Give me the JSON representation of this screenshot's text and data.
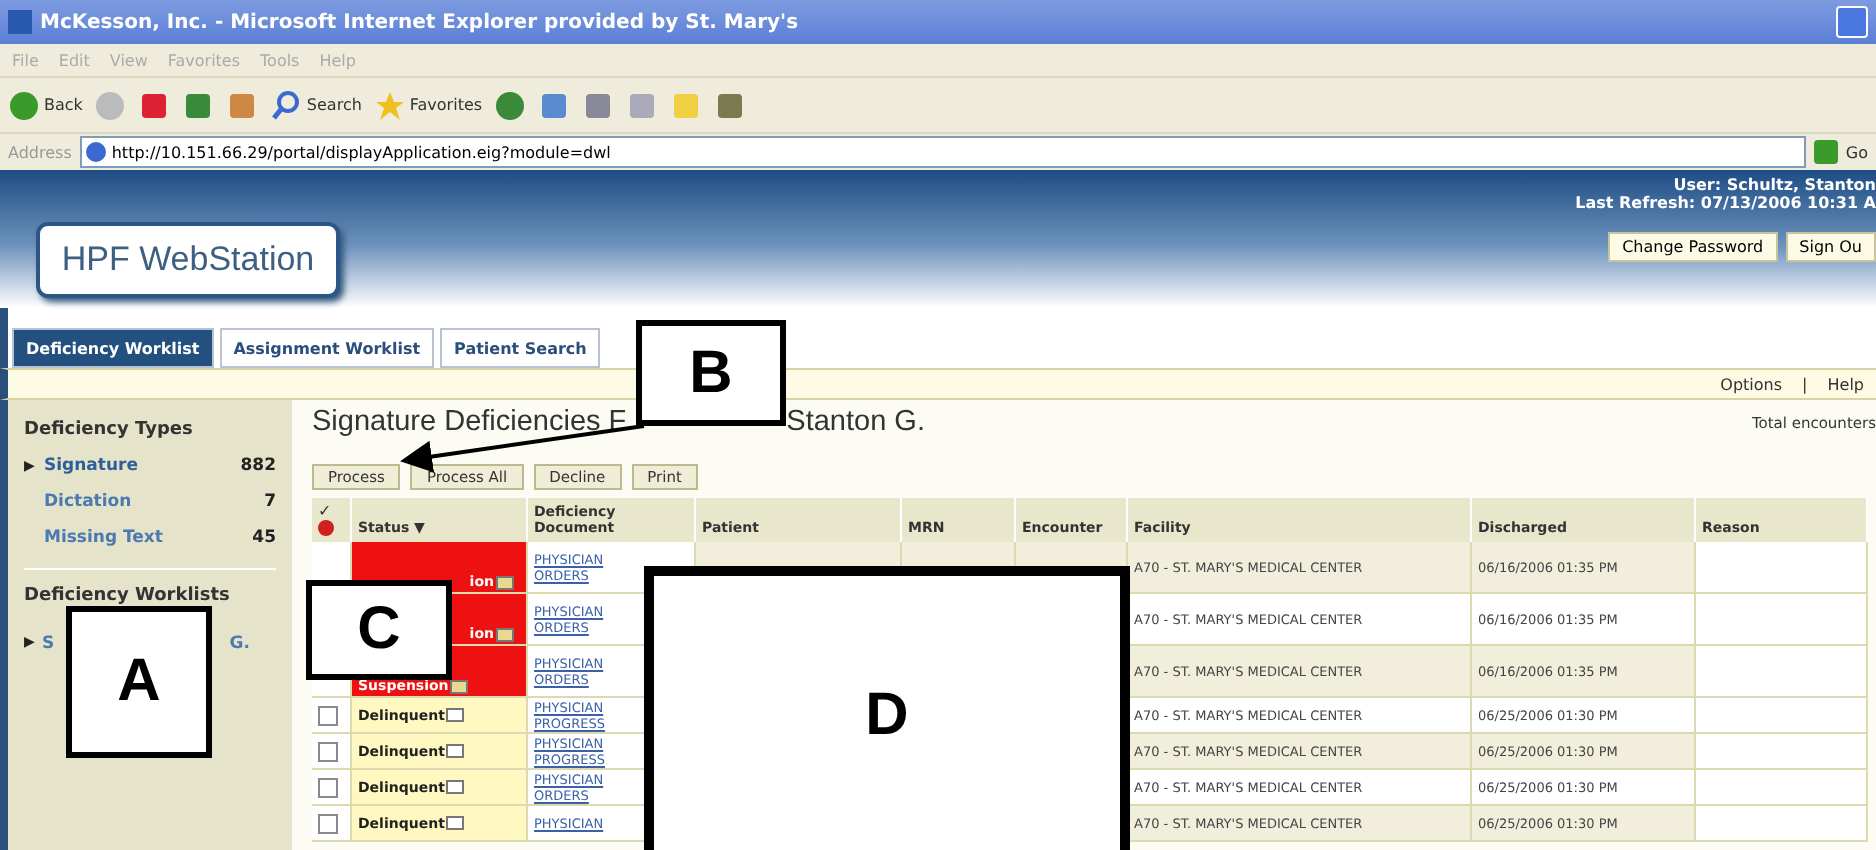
{
  "browser": {
    "title": "McKesson, Inc. - Microsoft Internet Explorer provided by St. Mary's",
    "menu": [
      "File",
      "Edit",
      "View",
      "Favorites",
      "Tools",
      "Help"
    ],
    "toolbar": [
      {
        "kind": "back",
        "label": "Back"
      },
      {
        "kind": "forward"
      },
      {
        "kind": "stop"
      },
      {
        "kind": "refresh"
      },
      {
        "kind": "home"
      },
      {
        "kind": "search",
        "label": "Search"
      },
      {
        "kind": "favorites",
        "label": "Favorites"
      },
      {
        "kind": "history"
      },
      {
        "kind": "mail"
      },
      {
        "kind": "print"
      },
      {
        "kind": "edit"
      },
      {
        "kind": "notes"
      },
      {
        "kind": "messenger"
      }
    ],
    "address_label": "Address",
    "url": "http://10.151.66.29/portal/displayApplication.eig?module=dwl",
    "go": "Go"
  },
  "app": {
    "logo": "HPF WebStation",
    "user": "User: Schultz, Stanton",
    "refresh": "Last Refresh: 07/13/2006 10:31 A",
    "header_buttons": [
      "Change Password",
      "Sign Ou"
    ],
    "tabs": [
      {
        "label": "Deficiency Worklist",
        "selected": true
      },
      {
        "label": "Assignment Worklist",
        "selected": false
      },
      {
        "label": "Patient Search",
        "selected": false
      }
    ],
    "links": [
      "Options",
      "Help"
    ],
    "link_separator": "|"
  },
  "sidebar": {
    "types_heading": "Deficiency Types",
    "types": [
      {
        "label": "Signature",
        "count": "882",
        "selected": true,
        "marker": "▶"
      },
      {
        "label": "Dictation",
        "count": "7",
        "selected": false
      },
      {
        "label": "Missing Text",
        "count": "45",
        "selected": false
      }
    ],
    "worklists_heading": "Deficiency Worklists",
    "worklist": {
      "marker": "▶",
      "start": "S",
      "end": "G."
    }
  },
  "main": {
    "title_start": "Signature Deficiencies F",
    "title_end": "Stanton G.",
    "total": "Total encounters",
    "buttons": [
      "Process",
      "Process All",
      "Decline",
      "Print"
    ],
    "check_header": "✓",
    "columns": [
      "Status",
      "Deficiency Document",
      "Patient",
      "MRN",
      "Encounter",
      "Facility",
      "Discharged",
      "Reason"
    ],
    "sort_mark": "▼",
    "rows": [
      {
        "kind": "suspension",
        "status": "ion",
        "partial": true,
        "doc": [
          "PHYSICIAN",
          "ORDERS"
        ],
        "facility": "A70 - ST. MARY'S MEDICAL CENTER",
        "discharged": "06/16/2006 01:35 PM"
      },
      {
        "kind": "suspension",
        "status": "ion",
        "partial": true,
        "doc": [
          "PHYSICIAN",
          "ORDERS"
        ],
        "facility": "A70 - ST. MARY'S MEDICAL CENTER",
        "discharged": "06/16/2006 01:35 PM"
      },
      {
        "kind": "suspension",
        "status": "Suspension",
        "partial": false,
        "doc": [
          "PHYSICIAN",
          "ORDERS"
        ],
        "facility": "A70 - ST. MARY'S MEDICAL CENTER",
        "discharged": "06/16/2006 01:35 PM"
      },
      {
        "kind": "delinquent",
        "status": "Delinquent",
        "partial": false,
        "checked": false,
        "doc": [
          "PHYSICIAN",
          "PROGRESS"
        ],
        "facility": "A70 - ST. MARY'S MEDICAL CENTER",
        "discharged": "06/25/2006 01:30 PM"
      },
      {
        "kind": "delinquent",
        "status": "Delinquent",
        "partial": false,
        "checked": false,
        "doc": [
          "PHYSICIAN",
          "PROGRESS"
        ],
        "facility": "A70 - ST. MARY'S MEDICAL CENTER",
        "discharged": "06/25/2006 01:30 PM"
      },
      {
        "kind": "delinquent",
        "status": "Delinquent",
        "partial": false,
        "checked": false,
        "doc": [
          "PHYSICIAN",
          "ORDERS"
        ],
        "facility": "A70 - ST. MARY'S MEDICAL CENTER",
        "discharged": "06/25/2006 01:30 PM"
      },
      {
        "kind": "delinquent",
        "status": "Delinquent",
        "partial": false,
        "checked": false,
        "doc": [
          "PHYSICIAN"
        ],
        "facility": "A70 - ST. MARY'S MEDICAL CENTER",
        "discharged": "06/25/2006 01:30 PM"
      }
    ]
  },
  "callouts": [
    {
      "letter": "A"
    },
    {
      "letter": "B",
      "arrow": true
    },
    {
      "letter": "C"
    },
    {
      "letter": "D"
    }
  ]
}
